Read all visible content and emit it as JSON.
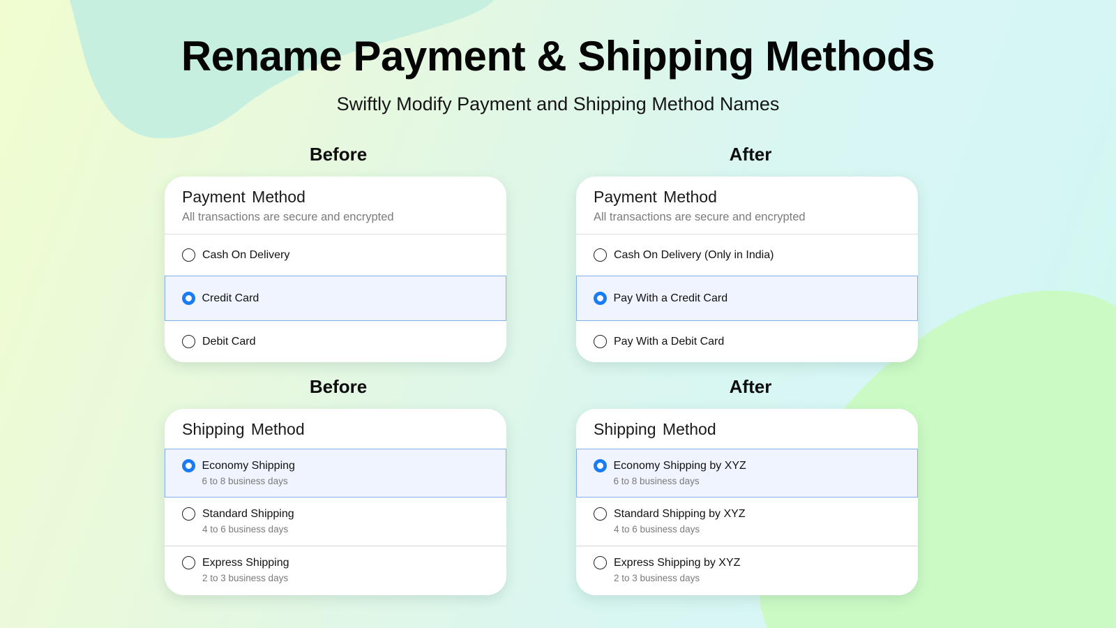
{
  "header": {
    "title": "Rename Payment & Shipping Methods",
    "subtitle": "Swiftly Modify Payment and Shipping Method Names"
  },
  "colors": {
    "accent": "#1a7cf5",
    "selected_bg": "#f0f4fe",
    "selected_border": "#82aee9",
    "blob_teal": "#c6efe0",
    "blob_green": "#ccfac4"
  },
  "payment": {
    "before": {
      "column_label": "Before",
      "title": "Payment Method",
      "subtitle": "All transactions are secure and encrypted",
      "options": [
        {
          "label": "Cash On Delivery",
          "selected": false
        },
        {
          "label": "Credit Card",
          "selected": true
        },
        {
          "label": "Debit Card",
          "selected": false
        }
      ]
    },
    "after": {
      "column_label": "After",
      "title": "Payment Method",
      "subtitle": "All transactions are secure and encrypted",
      "options": [
        {
          "label": "Cash On Delivery (Only in India)",
          "selected": false
        },
        {
          "label": "Pay With a Credit Card",
          "selected": true
        },
        {
          "label": "Pay With a Debit Card",
          "selected": false
        }
      ]
    }
  },
  "shipping": {
    "before": {
      "column_label": "Before",
      "title": "Shipping Method",
      "options": [
        {
          "label": "Economy Shipping",
          "detail": "6 to 8 business days",
          "selected": true
        },
        {
          "label": "Standard Shipping",
          "detail": "4 to 6 business days",
          "selected": false
        },
        {
          "label": "Express Shipping",
          "detail": "2 to 3 business days",
          "selected": false
        }
      ]
    },
    "after": {
      "column_label": "After",
      "title": "Shipping Method",
      "options": [
        {
          "label": "Economy Shipping by XYZ",
          "detail": "6 to 8 business days",
          "selected": true
        },
        {
          "label": "Standard Shipping by XYZ",
          "detail": "4 to 6 business days",
          "selected": false
        },
        {
          "label": "Express Shipping by XYZ",
          "detail": "2 to 3 business days",
          "selected": false
        }
      ]
    }
  }
}
